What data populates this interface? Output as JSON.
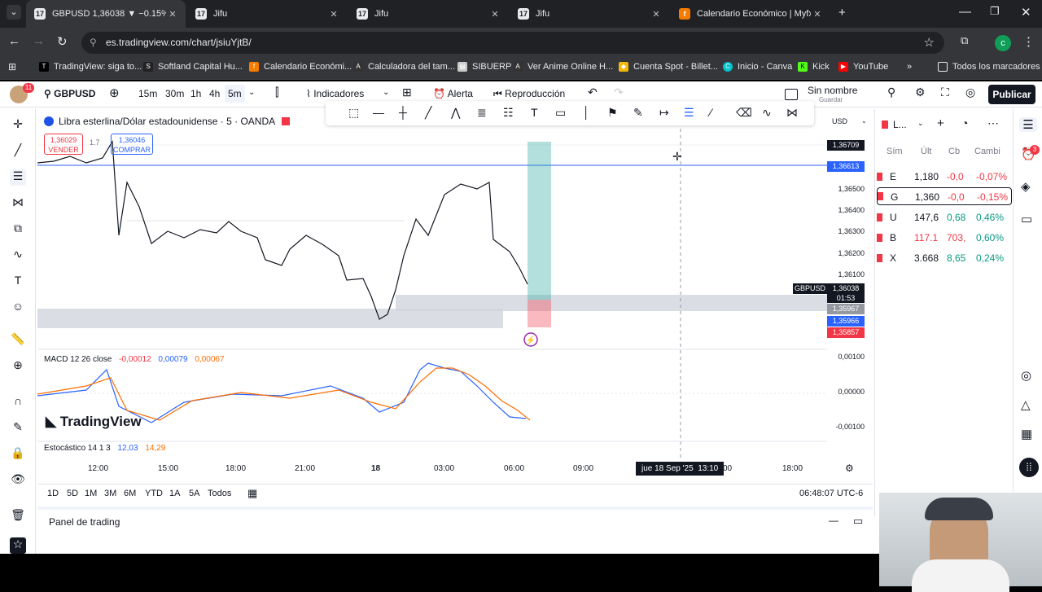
{
  "browser": {
    "tabs": [
      {
        "title": "GBPUSD 1,36038 ▼ −0.15% Sin",
        "active": true,
        "fav": "TV"
      },
      {
        "title": "Jifu",
        "active": false,
        "fav": "TV"
      },
      {
        "title": "Jifu",
        "active": false,
        "fav": "TV"
      },
      {
        "title": "Jifu",
        "active": false,
        "fav": "TV"
      },
      {
        "title": "Calendario Económico | Myfxbo",
        "active": false,
        "fav": "f"
      }
    ],
    "url": "es.tradingview.com/chart/jsiuYjtB/",
    "bookmarks": [
      "TradingView: siga to...",
      "Softland Capital Hu...",
      "Calendario Económi...",
      "Calculadora del tam...",
      "SIBUERP",
      "Ver Anime Online H...",
      "Cuenta Spot - Billet...",
      "Inicio - Canva",
      "Kick",
      "YouTube",
      "Todos los marcadores"
    ],
    "profile_initial": "c"
  },
  "toolbar": {
    "symbol": "GBPUSD",
    "intervals": [
      "15m",
      "30m",
      "1h",
      "4h",
      "5m"
    ],
    "indicators": "Indicadores",
    "alert": "Alerta",
    "replay": "Reproducción",
    "layout_name": "Sin nombre",
    "layout_saved": "Guardar",
    "publish": "Publicar",
    "notif_count": "11"
  },
  "chart": {
    "title": "Libra esterlina/Dólar estadounidense · 5 · OANDA",
    "sell_price": "1,36029",
    "sell_label": "VENDER",
    "spread": "1.7",
    "buy_price": "1,36046",
    "buy_label": "COMPRAR",
    "currency": "USD",
    "price_labels": [
      "1,36500",
      "1,36400",
      "1,36300",
      "1,36200",
      "1,36100",
      "1,35900"
    ],
    "tags": {
      "top": "1,36709",
      "line": "1,36613",
      "sym": "GBPUSD",
      "last": "1,36038",
      "timer": "01:53",
      "grey": "1,35967",
      "blue": "1,35966",
      "red": "1,35857"
    },
    "macd_label": "MACD 12 26 close",
    "macd_vals": [
      "-0,00012",
      "0,00079",
      "0,00067"
    ],
    "macd_axis": [
      "0,00100",
      "0,00000",
      "-0,00100"
    ],
    "stoch_label": "Estocástico 14 1 3",
    "stoch_vals": [
      "12,03",
      "14,29"
    ],
    "brand": "TradingView",
    "time_labels": [
      "12:00",
      "15:00",
      "18:00",
      "21:00",
      "18",
      "03:00",
      "06:00",
      "09:00",
      "18:00"
    ],
    "crosshair_time": "jue 18 Sep '25",
    "crosshair_clock": "13:10",
    "crosshair_suffix": "00",
    "ranges": [
      "1D",
      "5D",
      "1M",
      "3M",
      "6M",
      "YTD",
      "1A",
      "5A",
      "Todos"
    ],
    "clock": "06:48:07 UTC-6",
    "panel": "Panel de trading"
  },
  "watchlist": {
    "header": "L...",
    "cols": [
      "Sím",
      "Últ",
      "Cb",
      "Cambi"
    ],
    "rows": [
      {
        "sym": "E",
        "last": "1,180",
        "chg": "-0,0",
        "pct": "-0,07%",
        "color": "#f23645"
      },
      {
        "sym": "G",
        "last": "1,360",
        "chg": "-0,0",
        "pct": "-0,15%",
        "color": "#f23645"
      },
      {
        "sym": "U",
        "last": "147,6",
        "chg": "0,68",
        "pct": "0,46%",
        "color": "#089981"
      },
      {
        "sym": "B",
        "last": "117.1",
        "chg": "703,",
        "pct": "0,60%",
        "color": "#f23645"
      },
      {
        "sym": "X",
        "last": "3.668",
        "chg": "8,65",
        "pct": "0,24%",
        "color": "#089981"
      }
    ],
    "alert_count": "3"
  }
}
